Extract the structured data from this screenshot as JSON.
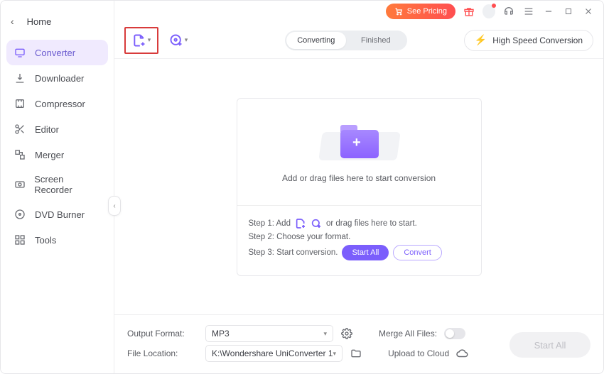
{
  "nav": {
    "back_label": "Home",
    "items": [
      {
        "label": "Converter"
      },
      {
        "label": "Downloader"
      },
      {
        "label": "Compressor"
      },
      {
        "label": "Editor"
      },
      {
        "label": "Merger"
      },
      {
        "label": "Screen Recorder"
      },
      {
        "label": "DVD Burner"
      },
      {
        "label": "Tools"
      }
    ]
  },
  "titlebar": {
    "pricing_label": "See Pricing"
  },
  "toolbar": {
    "tabs": {
      "converting": "Converting",
      "finished": "Finished"
    },
    "hs_label": "High Speed Conversion"
  },
  "dropzone": {
    "text": "Add or drag files here to start conversion"
  },
  "steps": {
    "s1_prefix": "Step 1: Add",
    "s1_suffix": "or drag files here to start.",
    "s2": "Step 2: Choose your format.",
    "s3_prefix": "Step 3: Start conversion.",
    "start_all_btn": "Start All",
    "convert_btn": "Convert"
  },
  "footer": {
    "output_label": "Output Format:",
    "output_value": "MP3",
    "merge_label": "Merge All Files:",
    "location_label": "File Location:",
    "location_value": "K:\\Wondershare UniConverter 1",
    "upload_label": "Upload to Cloud",
    "start_all": "Start All"
  }
}
